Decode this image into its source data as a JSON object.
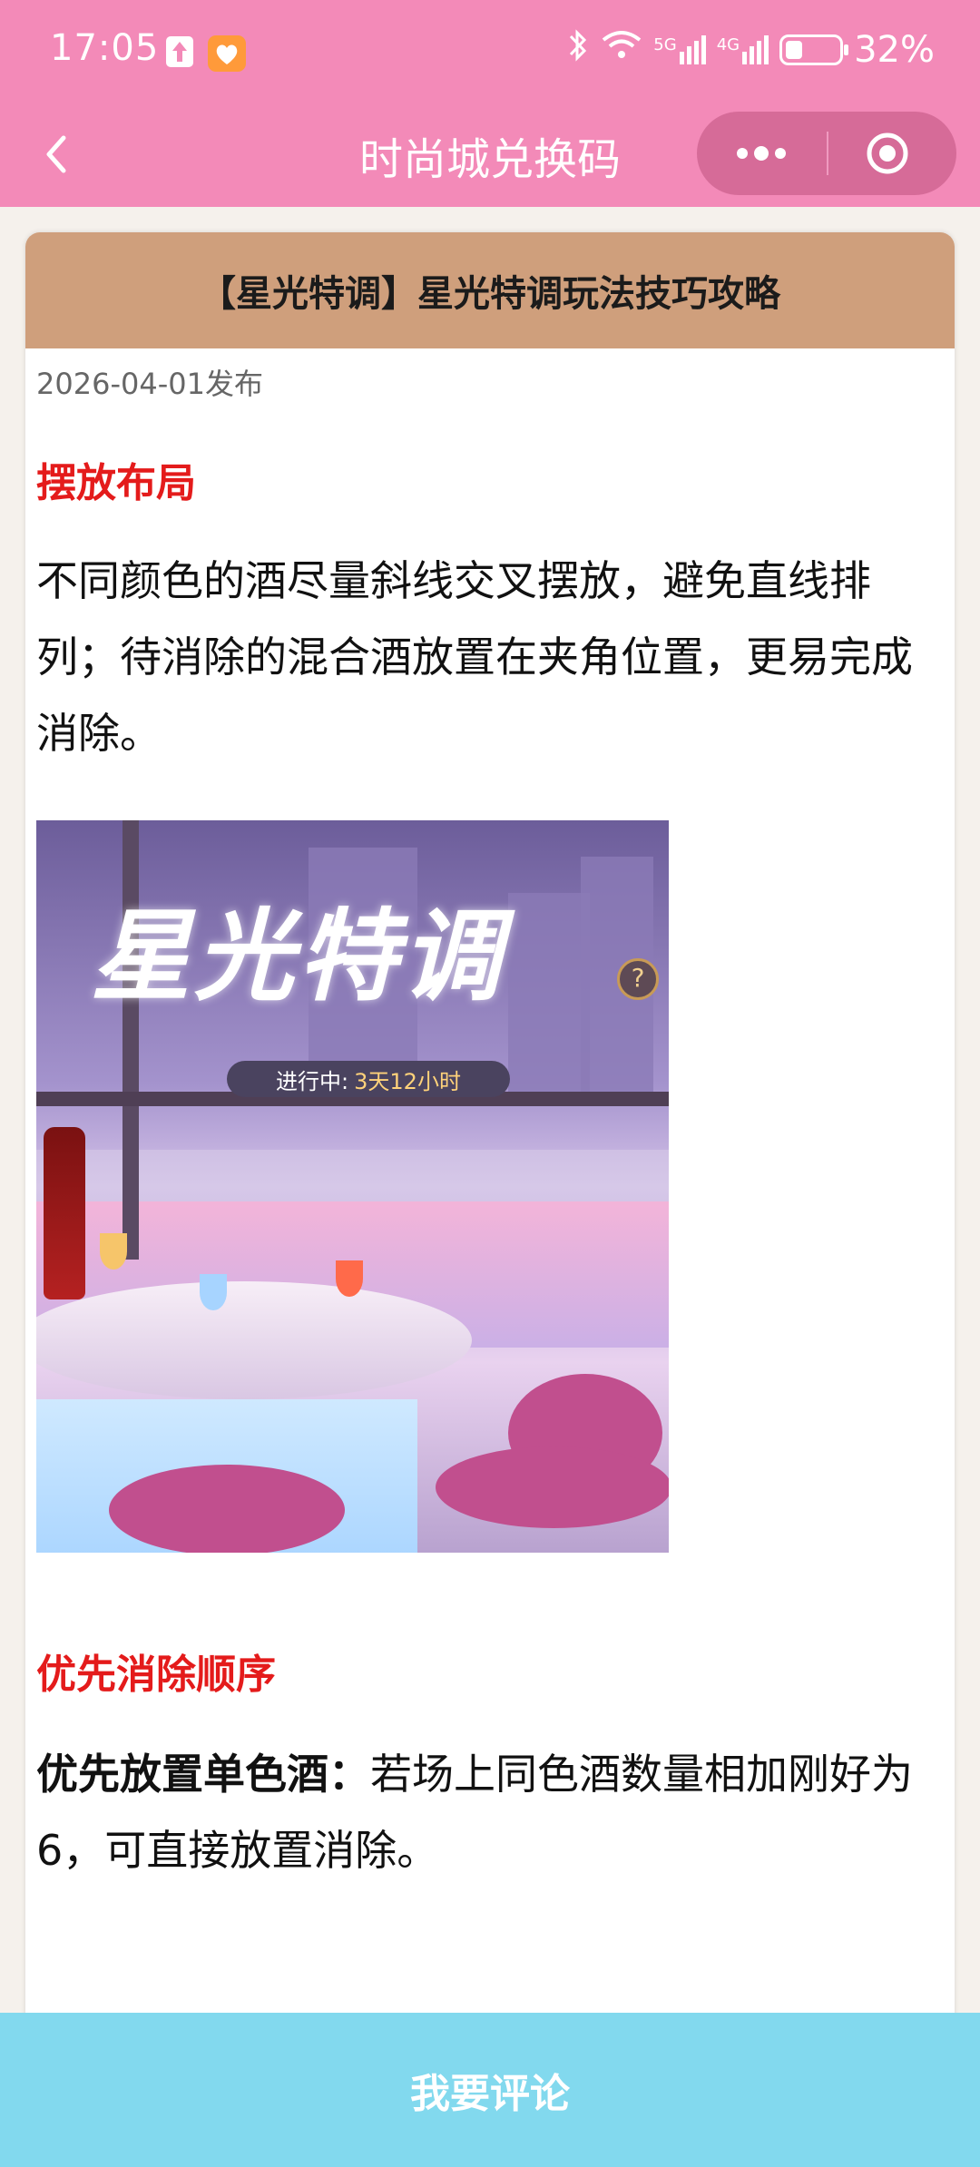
{
  "status_bar": {
    "time": "17:05",
    "signal_1": "5G",
    "signal_2": "4G",
    "battery_percent": "32%",
    "battery_level": 0.32
  },
  "nav": {
    "title": "时尚城兑换码"
  },
  "article": {
    "title": "【星光特调】星光特调玩法技巧攻略",
    "date": "2026-04-01发布",
    "section1_title": "摆放布局",
    "section1_text": "不同颜色的酒尽量斜线交叉摆放，避免直线排列；待消除的混合酒放置在夹角位置，更易完成消除。",
    "image": {
      "title": "星光特调",
      "status_label": "进行中:",
      "status_value": "3天12小时",
      "help": "?"
    },
    "section2_title": "优先消除顺序",
    "section2_bold": "优先放置单色酒：",
    "section2_text": "若场上同色酒数量相加刚好为 6，可直接放置消除。"
  },
  "bottom_bar": {
    "label": "我要评论"
  },
  "colors": {
    "header": "#f38ab8",
    "card_header": "#cf9f7c",
    "section_title": "#e41b1b",
    "bottom_bar": "#82d9ee"
  }
}
